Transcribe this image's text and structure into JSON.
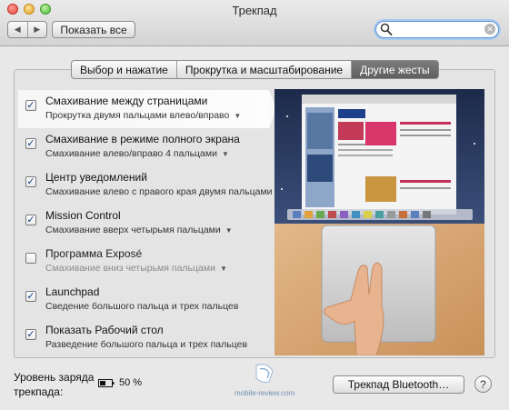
{
  "window": {
    "title": "Трекпад",
    "show_all_label": "Показать все",
    "search": {
      "value": "",
      "placeholder": ""
    }
  },
  "tabs": [
    {
      "label": "Выбор и нажатие",
      "active": false
    },
    {
      "label": "Прокрутка и масштабирование",
      "active": false
    },
    {
      "label": "Другие жесты",
      "active": true
    }
  ],
  "gestures": [
    {
      "title": "Смахивание между страницами",
      "subtitle": "Прокрутка двумя пальцами влево/вправо",
      "has_dropdown": true,
      "checked": true,
      "selected": true
    },
    {
      "title": "Смахивание в режиме полного экрана",
      "subtitle": "Смахивание влево/вправо 4 пальцами",
      "has_dropdown": true,
      "checked": true,
      "selected": false
    },
    {
      "title": "Центр уведомлений",
      "subtitle": "Смахивание влево с правого края двумя пальцами",
      "has_dropdown": false,
      "checked": true,
      "selected": false
    },
    {
      "title": "Mission Control",
      "subtitle": "Смахивание вверх четырьмя пальцами",
      "has_dropdown": true,
      "checked": true,
      "selected": false
    },
    {
      "title": "Программа Exposé",
      "subtitle": "Смахивание вниз четырьмя пальцами",
      "has_dropdown": true,
      "checked": false,
      "selected": false
    },
    {
      "title": "Launchpad",
      "subtitle": "Сведение большого пальца и трех пальцев",
      "has_dropdown": false,
      "checked": true,
      "selected": false
    },
    {
      "title": "Показать Рабочий стол",
      "subtitle": "Разведение большого пальца и трех пальцев",
      "has_dropdown": false,
      "checked": true,
      "selected": false
    }
  ],
  "footer": {
    "battery_label_line1": "Уровень заряда",
    "battery_label_line2": "трекпада:",
    "battery_value": "50 %",
    "battery_level": 0.5,
    "bluetooth_button_label": "Трекпад Bluetooth…",
    "help_label": "?",
    "watermark_text": "mobile-review.com"
  },
  "icons": {
    "back": "chevron-left-icon",
    "forward": "chevron-right-icon",
    "search": "search-icon",
    "clear": "clear-search-icon",
    "battery": "battery-icon",
    "help": "help-icon"
  },
  "colors": {
    "active_tab": "#6b6b6b",
    "checkmark": "#0b3f86",
    "search_focus": "#5d93d0"
  }
}
